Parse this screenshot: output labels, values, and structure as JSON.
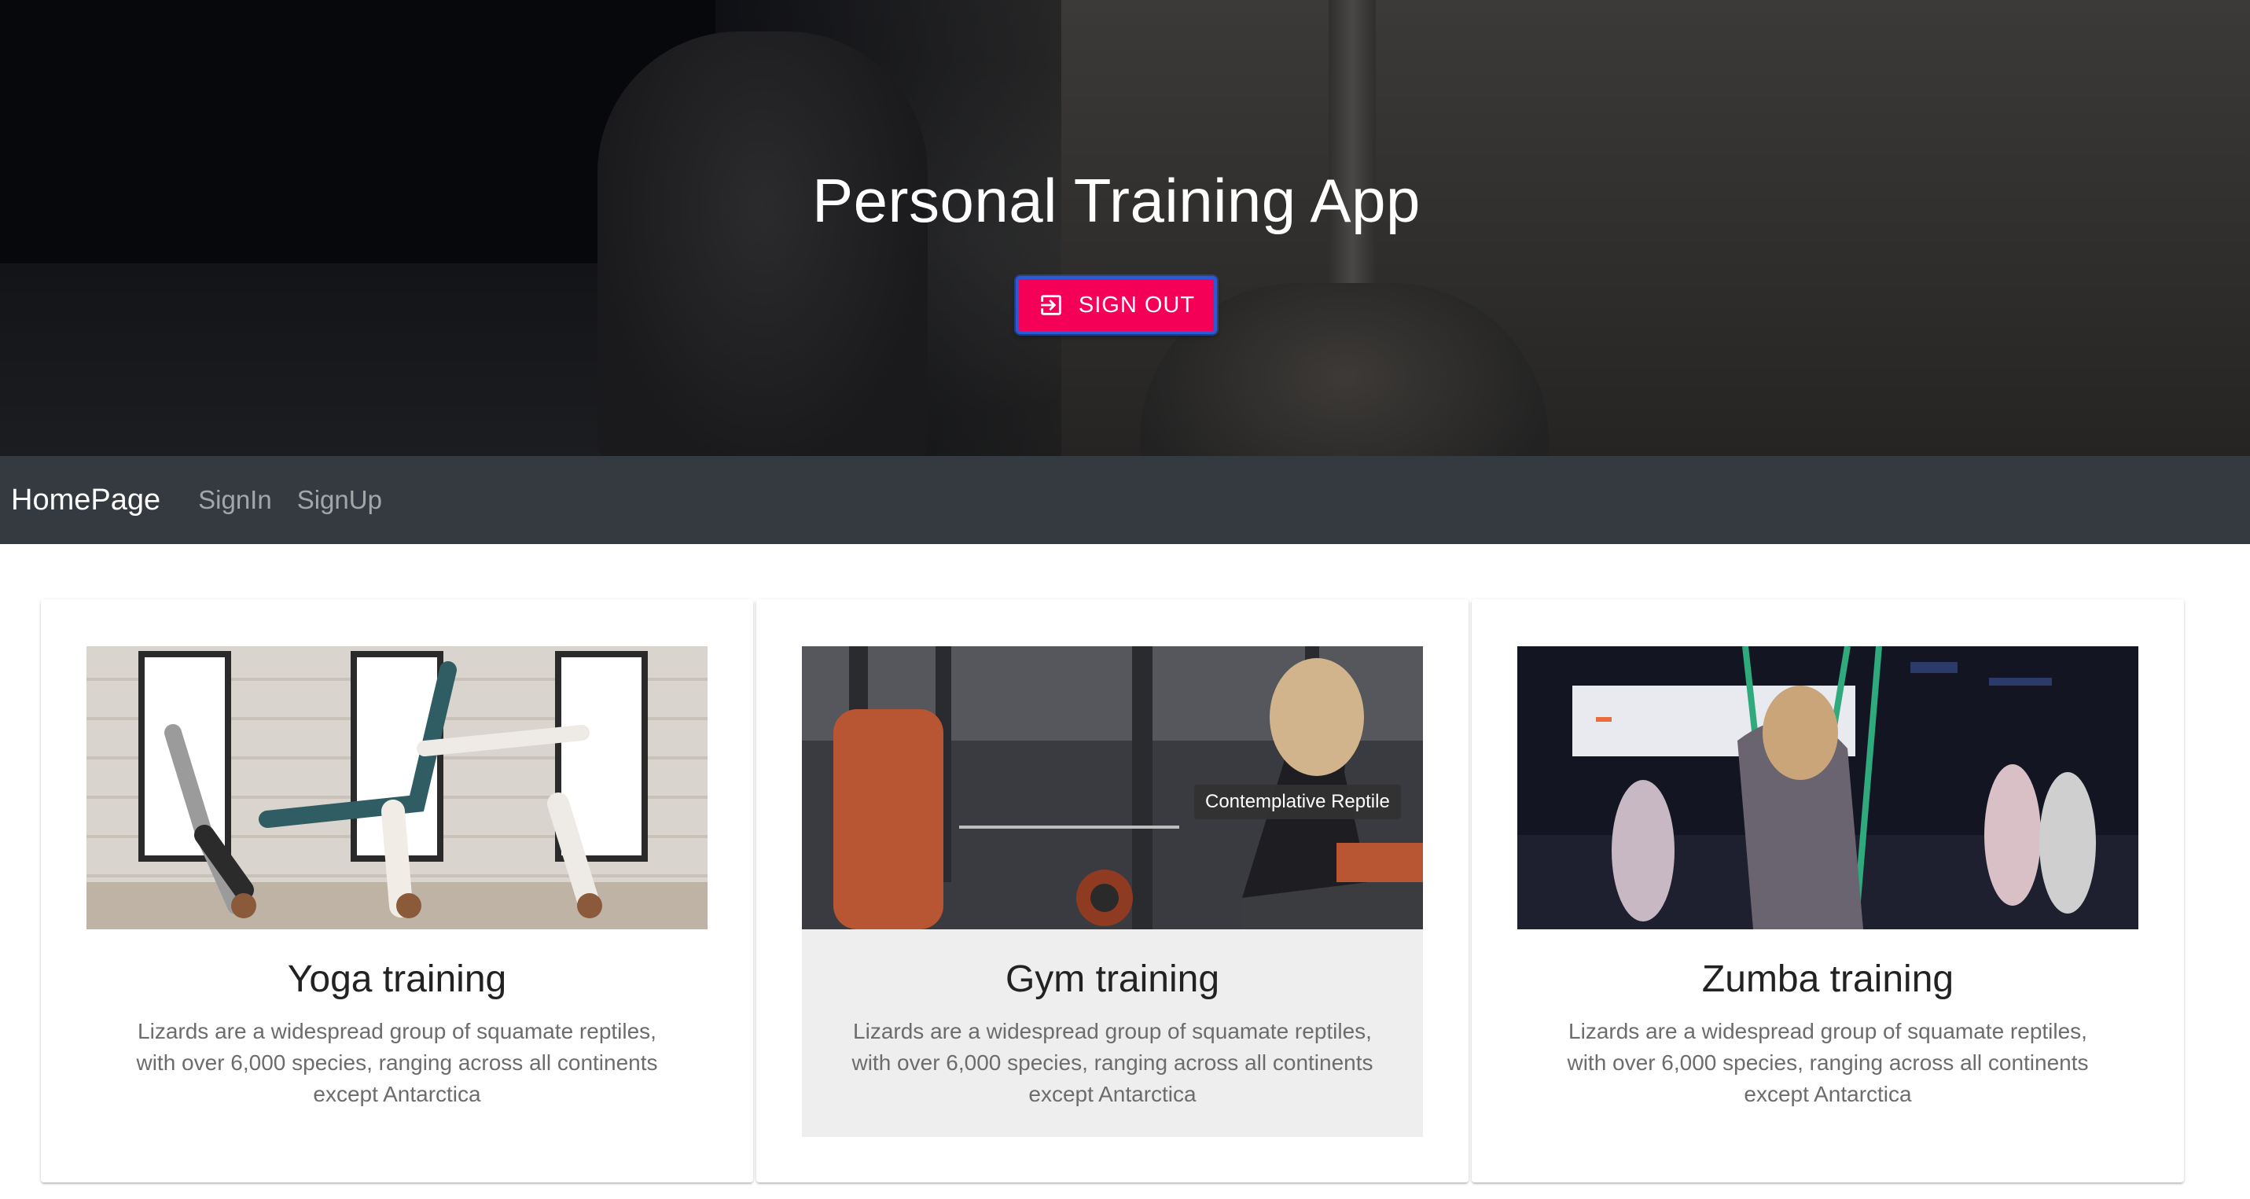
{
  "hero": {
    "title": "Personal Training App",
    "signout_label": "SIGN OUT",
    "signout_icon": "exit-to-app-icon",
    "accent_color": "#f50057"
  },
  "navbar": {
    "brand": "HomePage",
    "links": [
      "SignIn",
      "SignUp"
    ],
    "background": "#343a40"
  },
  "cards": [
    {
      "title": "Yoga training",
      "description": "Lizards are a widespread group of squamate reptiles, with over 6,000 species, ranging across all continents except Antarctica",
      "image": "yoga-handstand-photo"
    },
    {
      "title": "Gym training",
      "description": "Lizards are a widespread group of squamate reptiles, with over 6,000 species, ranging across all continents except Antarctica",
      "image": "gym-cable-machine-photo",
      "tooltip": "Contemplative Reptile"
    },
    {
      "title": "Zumba training",
      "description": "Lizards are a widespread group of squamate reptiles, with over 6,000 species, ranging across all continents except Antarctica",
      "image": "group-fitness-bands-photo"
    }
  ]
}
